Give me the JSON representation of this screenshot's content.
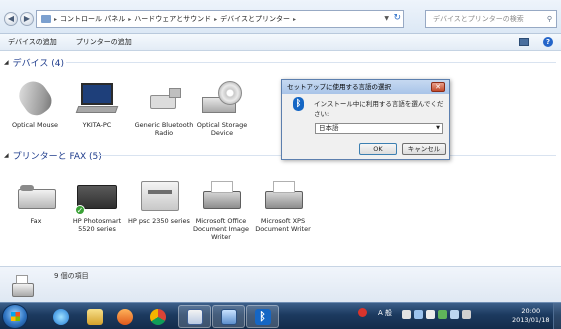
{
  "address": {
    "crumbs": [
      "コントロール パネル",
      "ハードウェアとサウンド",
      "デバイスとプリンター"
    ],
    "search_placeholder": "デバイスとプリンターの検索"
  },
  "toolbar": {
    "add_device": "デバイスの追加",
    "add_printer": "プリンターの追加"
  },
  "devices_section": {
    "title": "デバイス (4)",
    "items": [
      {
        "label": "Optical Mouse",
        "icon": "mouse-icon"
      },
      {
        "label": "YKITA-PC",
        "icon": "laptop-icon"
      },
      {
        "label": "Generic Bluetooth Radio",
        "icon": "bluetooth-adapter-icon"
      },
      {
        "label": "Optical Storage Device",
        "icon": "optical-drive-icon"
      }
    ]
  },
  "printers_section": {
    "title": "プリンターと FAX (5)",
    "items": [
      {
        "label": "Fax",
        "icon": "fax-icon"
      },
      {
        "label": "HP Photosmart 5520 series",
        "icon": "printer-icon",
        "default": true
      },
      {
        "label": "HP psc 2350 series",
        "icon": "printer-icon"
      },
      {
        "label": "Microsoft Office Document Image Writer",
        "icon": "printer-icon"
      },
      {
        "label": "Microsoft XPS Document Writer",
        "icon": "printer-icon"
      }
    ]
  },
  "dialog": {
    "title": "セットアップに使用する言語の選択",
    "message": "インストール中に利用する言語を選んでください:",
    "selected_language": "日本語",
    "ok": "OK",
    "cancel": "キャンセル"
  },
  "details": {
    "count": "9 個の項目"
  },
  "taskbar": {
    "ime_mode": "A 般",
    "time": "20:00",
    "date": "2013/01/18"
  },
  "colors": {
    "section_title": "#1e3c8c",
    "taskbar": "#1c3a5f",
    "default_check": "#3aa136"
  }
}
